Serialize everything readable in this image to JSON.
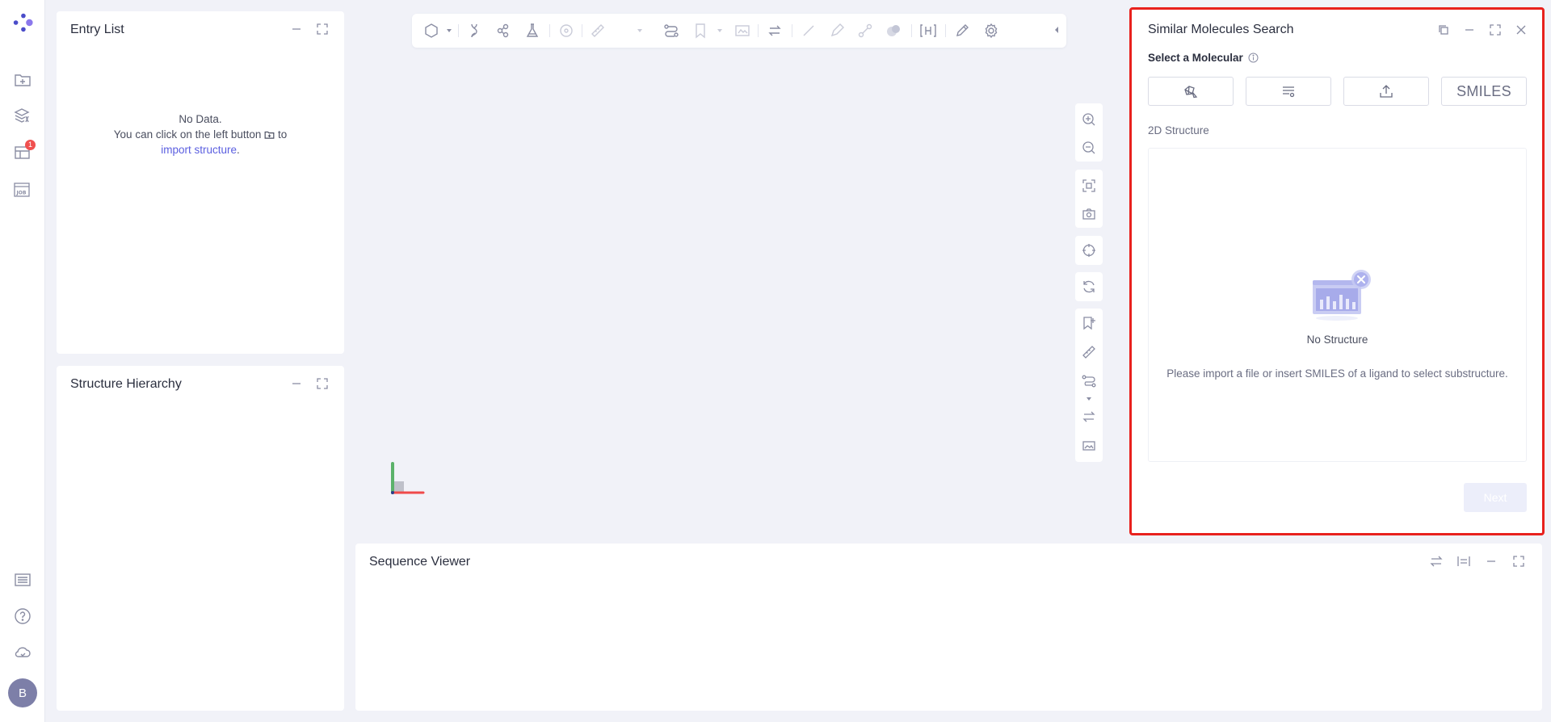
{
  "entry_list": {
    "title": "Entry List",
    "empty_line1": "No Data.",
    "empty_line2_a": "You can click on the left button",
    "empty_line2_b": "to",
    "empty_link": "import structure",
    "empty_end": "."
  },
  "structure_hierarchy": {
    "title": "Structure Hierarchy"
  },
  "sequence_viewer": {
    "title": "Sequence Viewer"
  },
  "rail": {
    "badge_count": "1",
    "avatar_letter": "B"
  },
  "similar_search": {
    "title": "Similar Molecules Search",
    "select_label": "Select a Molecular",
    "smiles_button": "SMILES",
    "structure_label": "2D Structure",
    "no_structure": "No Structure",
    "hint": "Please import a file or insert SMILES of a ligand to select substructure.",
    "next_button": "Next"
  },
  "colors": {
    "accent": "#5b5fe0",
    "highlight_border": "#e8211d",
    "badge": "#f0504f",
    "avatar": "#7d7fa8",
    "icon": "#8a8da3",
    "icon_disabled": "#c9cbd8"
  },
  "icons": {
    "rail": [
      "app-logo-icon",
      "import-folder-icon",
      "layers-icon",
      "table-icon",
      "job-icon",
      "list-icon",
      "help-icon",
      "cloud-icon"
    ],
    "toolbar": [
      "hexagon-icon",
      "dna-icon",
      "molecule-icon",
      "flask-icon",
      "target-icon",
      "ruler-icon",
      "path-icon",
      "bookmark-icon",
      "image-icon",
      "swap-icon",
      "line-icon",
      "pen-icon",
      "link-icon",
      "surface-icon",
      "hydrogen-icon",
      "edit-icon",
      "settings-icon"
    ],
    "viewer": [
      "zoom-in-icon",
      "zoom-out-icon",
      "fit-icon",
      "camera-icon",
      "center-icon",
      "rotate-icon",
      "bookmark-add-icon",
      "ruler-icon",
      "path-icon",
      "swap-icon",
      "image-icon"
    ]
  }
}
